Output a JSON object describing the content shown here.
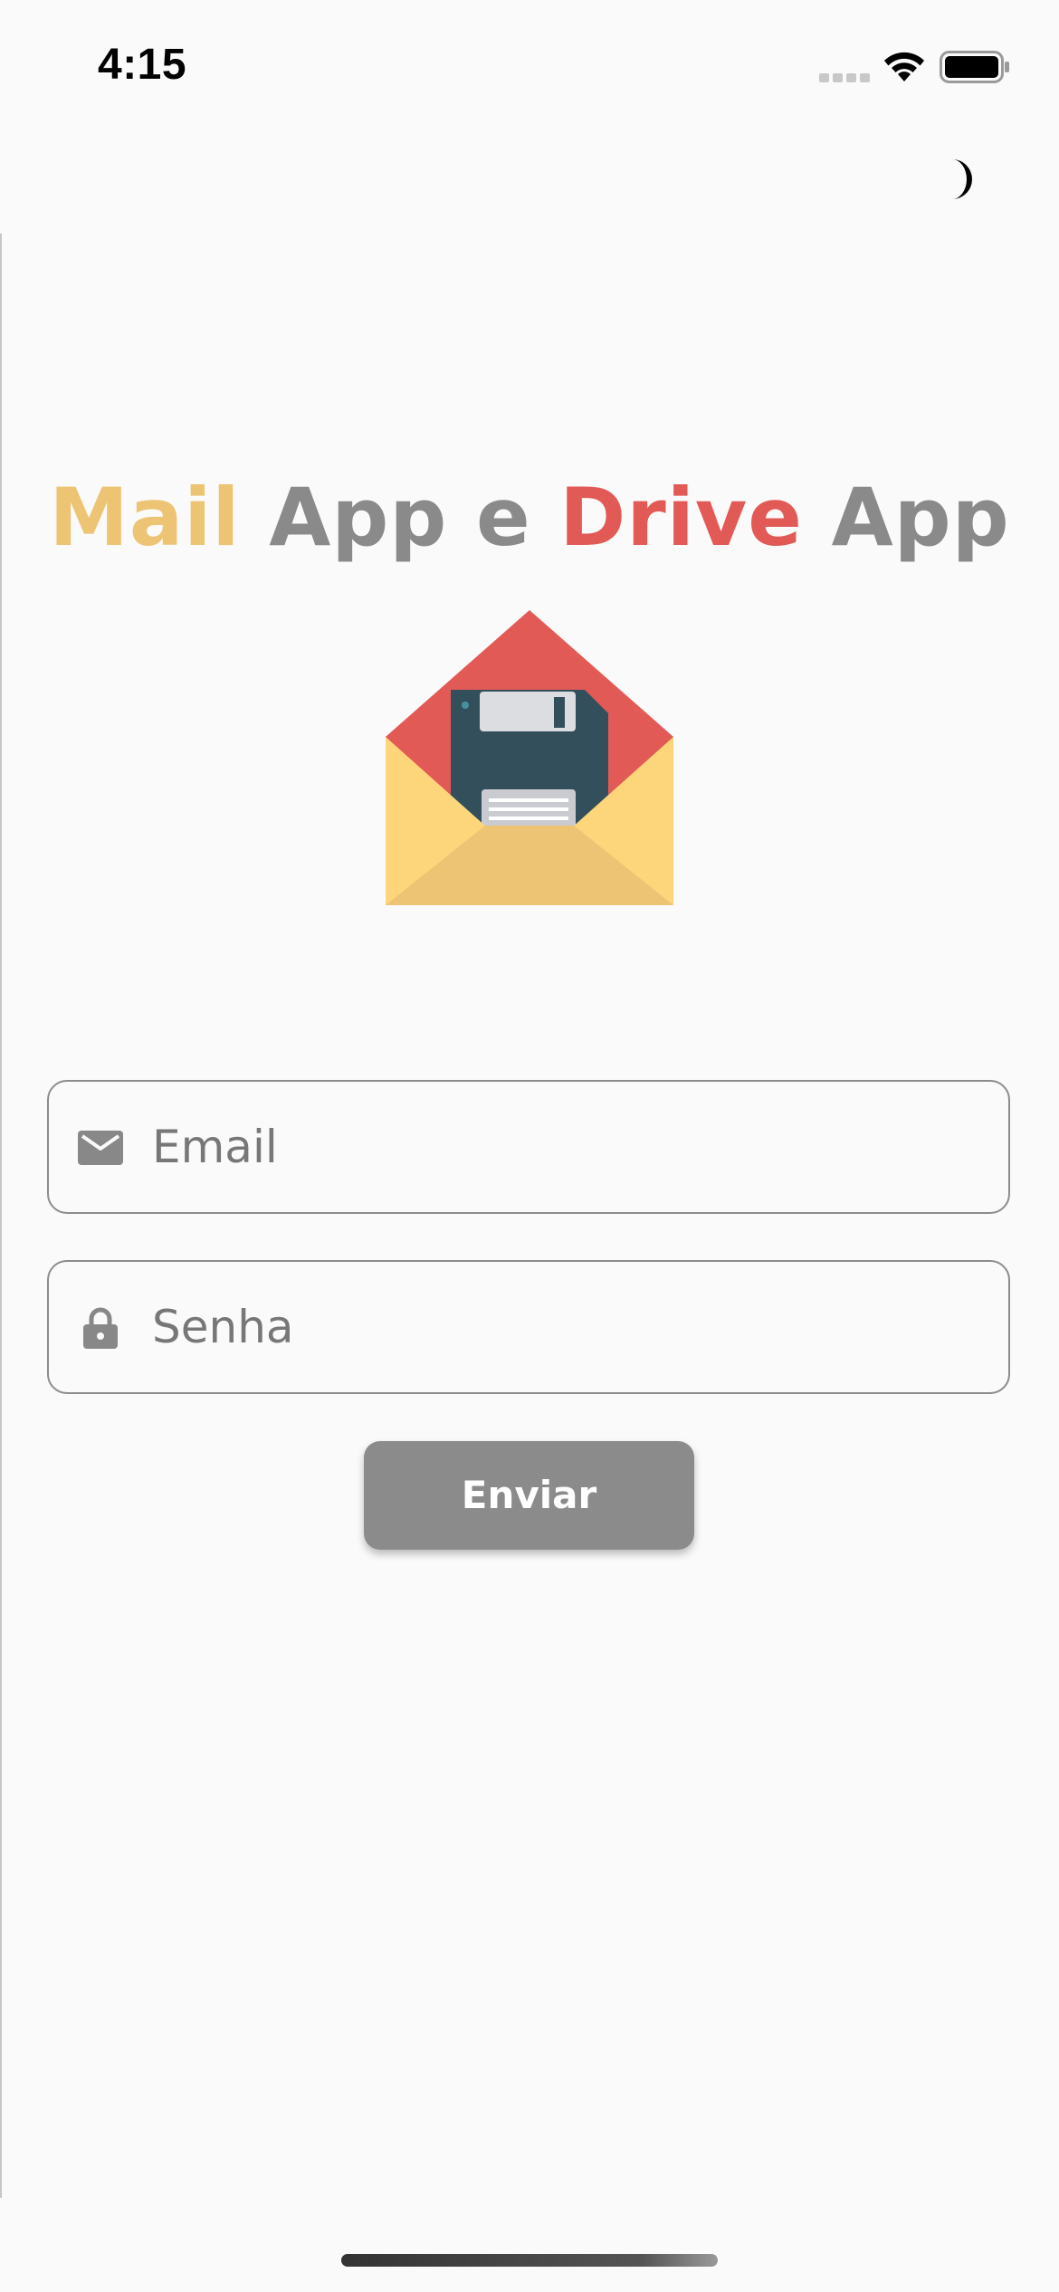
{
  "status_bar": {
    "time": "4:15"
  },
  "header": {
    "theme_toggle_icon": "moon-icon"
  },
  "title": {
    "part1": "Mail",
    "part2": "App e",
    "part3": "Drive",
    "part4": "App",
    "colors": {
      "mail": "#edc474",
      "neutral": "#8a8a8a",
      "drive": "#e25a56"
    }
  },
  "logo": {
    "icon": "envelope-floppy-icon"
  },
  "form": {
    "email": {
      "icon": "envelope-icon",
      "placeholder": "Email",
      "value": ""
    },
    "password": {
      "icon": "lock-icon",
      "placeholder": "Senha",
      "value": ""
    },
    "submit_label": "Enviar",
    "button_color": "#8b8b8b"
  }
}
